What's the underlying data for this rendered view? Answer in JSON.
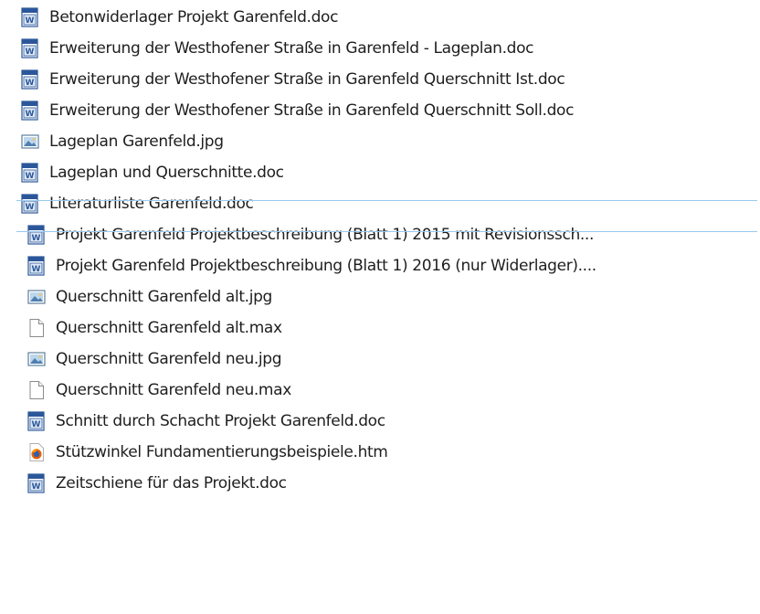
{
  "files": [
    {
      "name": "Betonwiderlager Projekt Garenfeld.doc",
      "icon": "word-document-icon"
    },
    {
      "name": "Erweiterung der Westhofener Straße in Garenfeld - Lageplan.doc",
      "icon": "word-document-icon"
    },
    {
      "name": "Erweiterung der Westhofener Straße in Garenfeld Querschnitt Ist.doc",
      "icon": "word-document-icon"
    },
    {
      "name": "Erweiterung der Westhofener Straße in Garenfeld Querschnitt Soll.doc",
      "icon": "word-document-icon"
    },
    {
      "name": "Lageplan Garenfeld.jpg",
      "icon": "image-file-icon"
    },
    {
      "name": "Lageplan und Querschnitte.doc",
      "icon": "word-document-icon"
    },
    {
      "name": "Literaturliste Garenfeld.doc",
      "icon": "word-document-icon"
    },
    {
      "name": "Projekt Garenfeld Projektbeschreibung (Blatt 1) 2015 mit Revisionssch...",
      "icon": "word-document-icon"
    },
    {
      "name": "Projekt Garenfeld Projektbeschreibung (Blatt 1) 2016 (nur Widerlager)....",
      "icon": "word-document-icon"
    },
    {
      "name": "Querschnitt Garenfeld alt.jpg",
      "icon": "image-file-icon"
    },
    {
      "name": "Querschnitt Garenfeld alt.max",
      "icon": "blank-file-icon"
    },
    {
      "name": "Querschnitt Garenfeld neu.jpg",
      "icon": "image-file-icon"
    },
    {
      "name": "Querschnitt Garenfeld neu.max",
      "icon": "blank-file-icon"
    },
    {
      "name": "Schnitt durch Schacht Projekt Garenfeld.doc",
      "icon": "word-document-icon"
    },
    {
      "name": "Stützwinkel Fundamentierungsbeispiele.htm",
      "icon": "firefox-html-icon"
    },
    {
      "name": "Zeitschiene für das Projekt.doc",
      "icon": "word-document-icon"
    }
  ],
  "colors": {
    "selection_border": "#99c9ef",
    "text": "#1e1e1e",
    "word_blue": "#2b579a"
  }
}
